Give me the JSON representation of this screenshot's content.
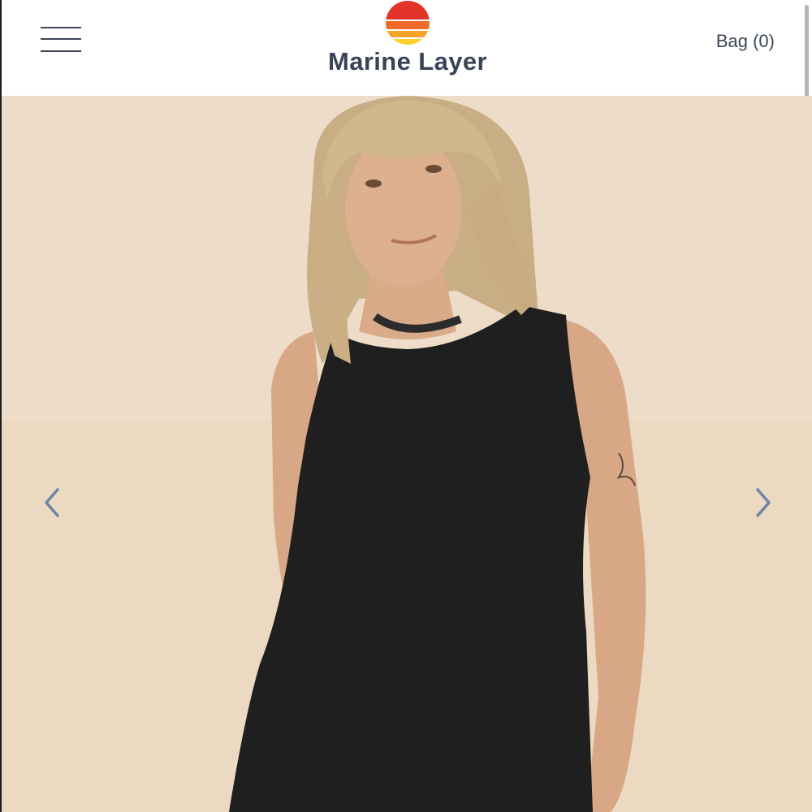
{
  "header": {
    "menu_icon": "hamburger-menu-icon",
    "brand": {
      "name": "Marine Layer",
      "logo_icon": "sunset-logo-icon",
      "logo_colors": [
        "#e4332b",
        "#ee6b2a",
        "#f6a429",
        "#fbd02f"
      ]
    },
    "bag_label": "Bag (0)"
  },
  "carousel": {
    "image_alt": "Model wearing a black sleeveless tank top",
    "prev_icon": "chevron-left-icon",
    "next_icon": "chevron-right-icon",
    "product_color": "#1f1f1f"
  },
  "colors": {
    "text_dark": "#3a4356",
    "arrow": "#6f84a6",
    "background_beige": "#ebd7bf"
  }
}
